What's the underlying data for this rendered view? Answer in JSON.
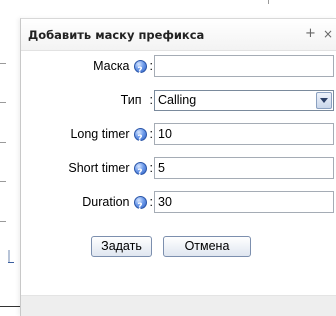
{
  "dialog": {
    "title": "Добавить маску префикса",
    "plus_label": "+",
    "close_label": "×"
  },
  "form": {
    "mask": {
      "label": "Маска",
      "value": ""
    },
    "type": {
      "label": "Тип",
      "selected": "Calling"
    },
    "long_timer": {
      "label": "Long timer",
      "value": "10"
    },
    "short_timer": {
      "label": "Short timer",
      "value": "5"
    },
    "duration": {
      "label": "Duration",
      "value": "30"
    }
  },
  "buttons": {
    "submit": "Задать",
    "cancel": "Отмена"
  },
  "icons": {
    "help": "help-icon",
    "dropdown": "chevron-down-icon"
  }
}
